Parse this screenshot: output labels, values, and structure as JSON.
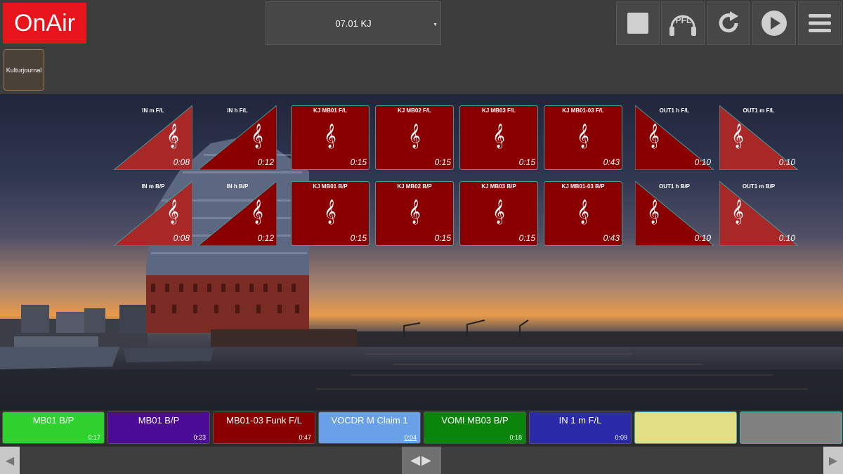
{
  "app": {
    "logo": "OnAir"
  },
  "header": {
    "selector_value": "07.01 KJ"
  },
  "toolbar": {
    "stop_icon": "stop-icon",
    "pfl_label": "PFL",
    "reload_icon": "reload-icon",
    "play_icon": "play-icon",
    "menu_icon": "hamburger-menu-icon"
  },
  "folder": {
    "label": "Kulturjournal"
  },
  "carts": [
    {
      "label": "IN m F/L",
      "time": "0:08",
      "shape": "tri-right",
      "color": "#a82828"
    },
    {
      "label": "IN h F/L",
      "time": "0:12",
      "shape": "tri-right",
      "color": "#8a0000"
    },
    {
      "label": "KJ MB01 F/L",
      "time": "0:15",
      "shape": "rect",
      "color": "#8a0000"
    },
    {
      "label": "KJ MB02 F/L",
      "time": "0:15",
      "shape": "rect",
      "color": "#8a0000"
    },
    {
      "label": "KJ MB03 F/L",
      "time": "0:15",
      "shape": "rect",
      "color": "#8a0000"
    },
    {
      "label": "KJ MB01-03 F/L",
      "time": "0:43",
      "shape": "rect",
      "color": "#8a0000"
    },
    {
      "label": "OUT1 h F/L",
      "time": "0:10",
      "shape": "tri-left",
      "color": "#8a0000"
    },
    {
      "label": "OUT1 m F/L",
      "time": "0:10",
      "shape": "tri-left",
      "color": "#a82828"
    },
    {
      "label": "IN m B/P",
      "time": "0:08",
      "shape": "tri-right",
      "color": "#a82828"
    },
    {
      "label": "IN h B/P",
      "time": "0:12",
      "shape": "tri-right",
      "color": "#8a0000"
    },
    {
      "label": "KJ MB01 B/P",
      "time": "0:15",
      "shape": "rect",
      "color": "#8a0000"
    },
    {
      "label": "KJ MB02 B/P",
      "time": "0:15",
      "shape": "rect",
      "color": "#8a0000"
    },
    {
      "label": "KJ MB03 B/P",
      "time": "0:15",
      "shape": "rect",
      "color": "#8a0000"
    },
    {
      "label": "KJ MB01-03 B/P",
      "time": "0:43",
      "shape": "rect",
      "color": "#8a0000"
    },
    {
      "label": "OUT1 h B/P",
      "time": "0:10",
      "shape": "tri-left",
      "color": "#8a0000"
    },
    {
      "label": "OUT1 m B/P",
      "time": "0:10",
      "shape": "tri-left",
      "color": "#a82828"
    }
  ],
  "playlist": [
    {
      "name": "MB01 B/P",
      "dur": "0:17",
      "color": "#2ed12e"
    },
    {
      "name": "MB01 B/P",
      "dur": "0:23",
      "color": "#4b0b94"
    },
    {
      "name": "MB01-03 Funk F/L",
      "dur": "0:47",
      "color": "#8a0000"
    },
    {
      "name": "VOCDR M Claim 1",
      "dur": "0:04",
      "color": "#6aa0e8",
      "underline": true
    },
    {
      "name": "VOMI MB03 B/P",
      "dur": "0:18",
      "color": "#0b840b"
    },
    {
      "name": "IN 1 m F/L",
      "dur": "0:09",
      "color": "#2a2aa8"
    },
    {
      "name": "",
      "dur": "",
      "color": "#e2de86"
    },
    {
      "name": "",
      "dur": "",
      "color": "#808080"
    }
  ],
  "scrollbar": {
    "left_icon": "arrow-left-icon",
    "right_icon": "arrow-right-icon",
    "thumb_icon": "split-handle-icon"
  }
}
